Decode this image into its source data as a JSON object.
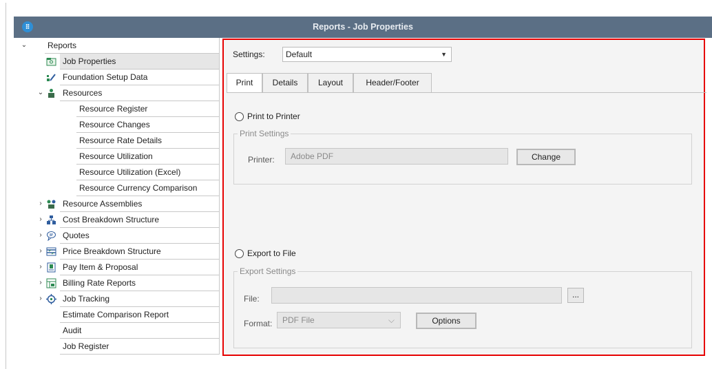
{
  "window": {
    "title": "Reports - Job Properties"
  },
  "tree": {
    "root": "Reports",
    "items": [
      "Job Properties",
      "Foundation Setup Data",
      "Resources",
      "Resource Register",
      "Resource Changes",
      "Resource Rate Details",
      "Resource Utilization",
      "Resource Utilization (Excel)",
      "Resource Currency Comparison",
      "Resource Assemblies",
      "Cost Breakdown Structure",
      "Quotes",
      "Price Breakdown Structure",
      "Pay Item & Proposal",
      "Billing Rate Reports",
      "Job Tracking",
      "Estimate Comparison Report",
      "Audit",
      "Job Register"
    ]
  },
  "panel": {
    "settings_label": "Settings:",
    "settings_value": "Default",
    "tabs": [
      "Print",
      "Details",
      "Layout",
      "Header/Footer"
    ],
    "print_to_printer": "Print to Printer",
    "print_settings": "Print Settings",
    "printer_label": "Printer:",
    "printer_value": "Adobe PDF",
    "change_button": "Change",
    "export_to_file": "Export to File",
    "export_settings": "Export Settings",
    "file_label": "File:",
    "browse_button": "...",
    "format_label": "Format:",
    "format_value": "PDF File",
    "options_button": "Options"
  },
  "colors": {
    "titlebar": "#5b6f85",
    "highlight_border": "#e60000",
    "selected_row": "#e6e6e6"
  }
}
